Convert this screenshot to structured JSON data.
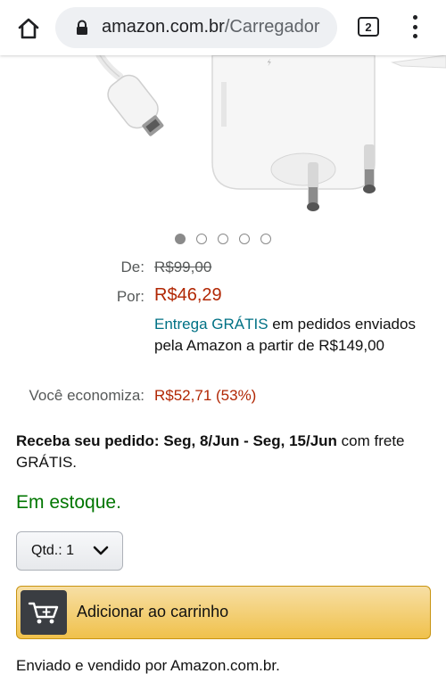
{
  "browser": {
    "url_domain": "amazon.com.br",
    "url_path": "/Carregador",
    "tab_count": "2"
  },
  "carousel": {
    "total": 5,
    "active": 1
  },
  "pricing": {
    "de_label": "De:",
    "de_value": "R$99,00",
    "por_label": "Por:",
    "por_value": "R$46,29",
    "free_link": "Entrega GRÁTIS",
    "free_text": " em pedidos enviados pela Amazon a partir de R$149,00",
    "save_label": "Você economiza:",
    "save_value": "R$52,71 (53%)"
  },
  "delivery": {
    "bold": "Receba seu pedido: Seg, 8/Jun - Seg, 15/Jun",
    "rest": " com frete GRÁTIS."
  },
  "stock": "Em estoque.",
  "quantity": {
    "label": "Qtd.:",
    "value": "1"
  },
  "cart_button": "Adicionar ao carrinho",
  "sold_by": "Enviado e vendido por Amazon.com.br.",
  "colors": {
    "price": "#b12704",
    "link": "#007185",
    "stock": "#007600",
    "cart_button": "#f0c14b"
  }
}
